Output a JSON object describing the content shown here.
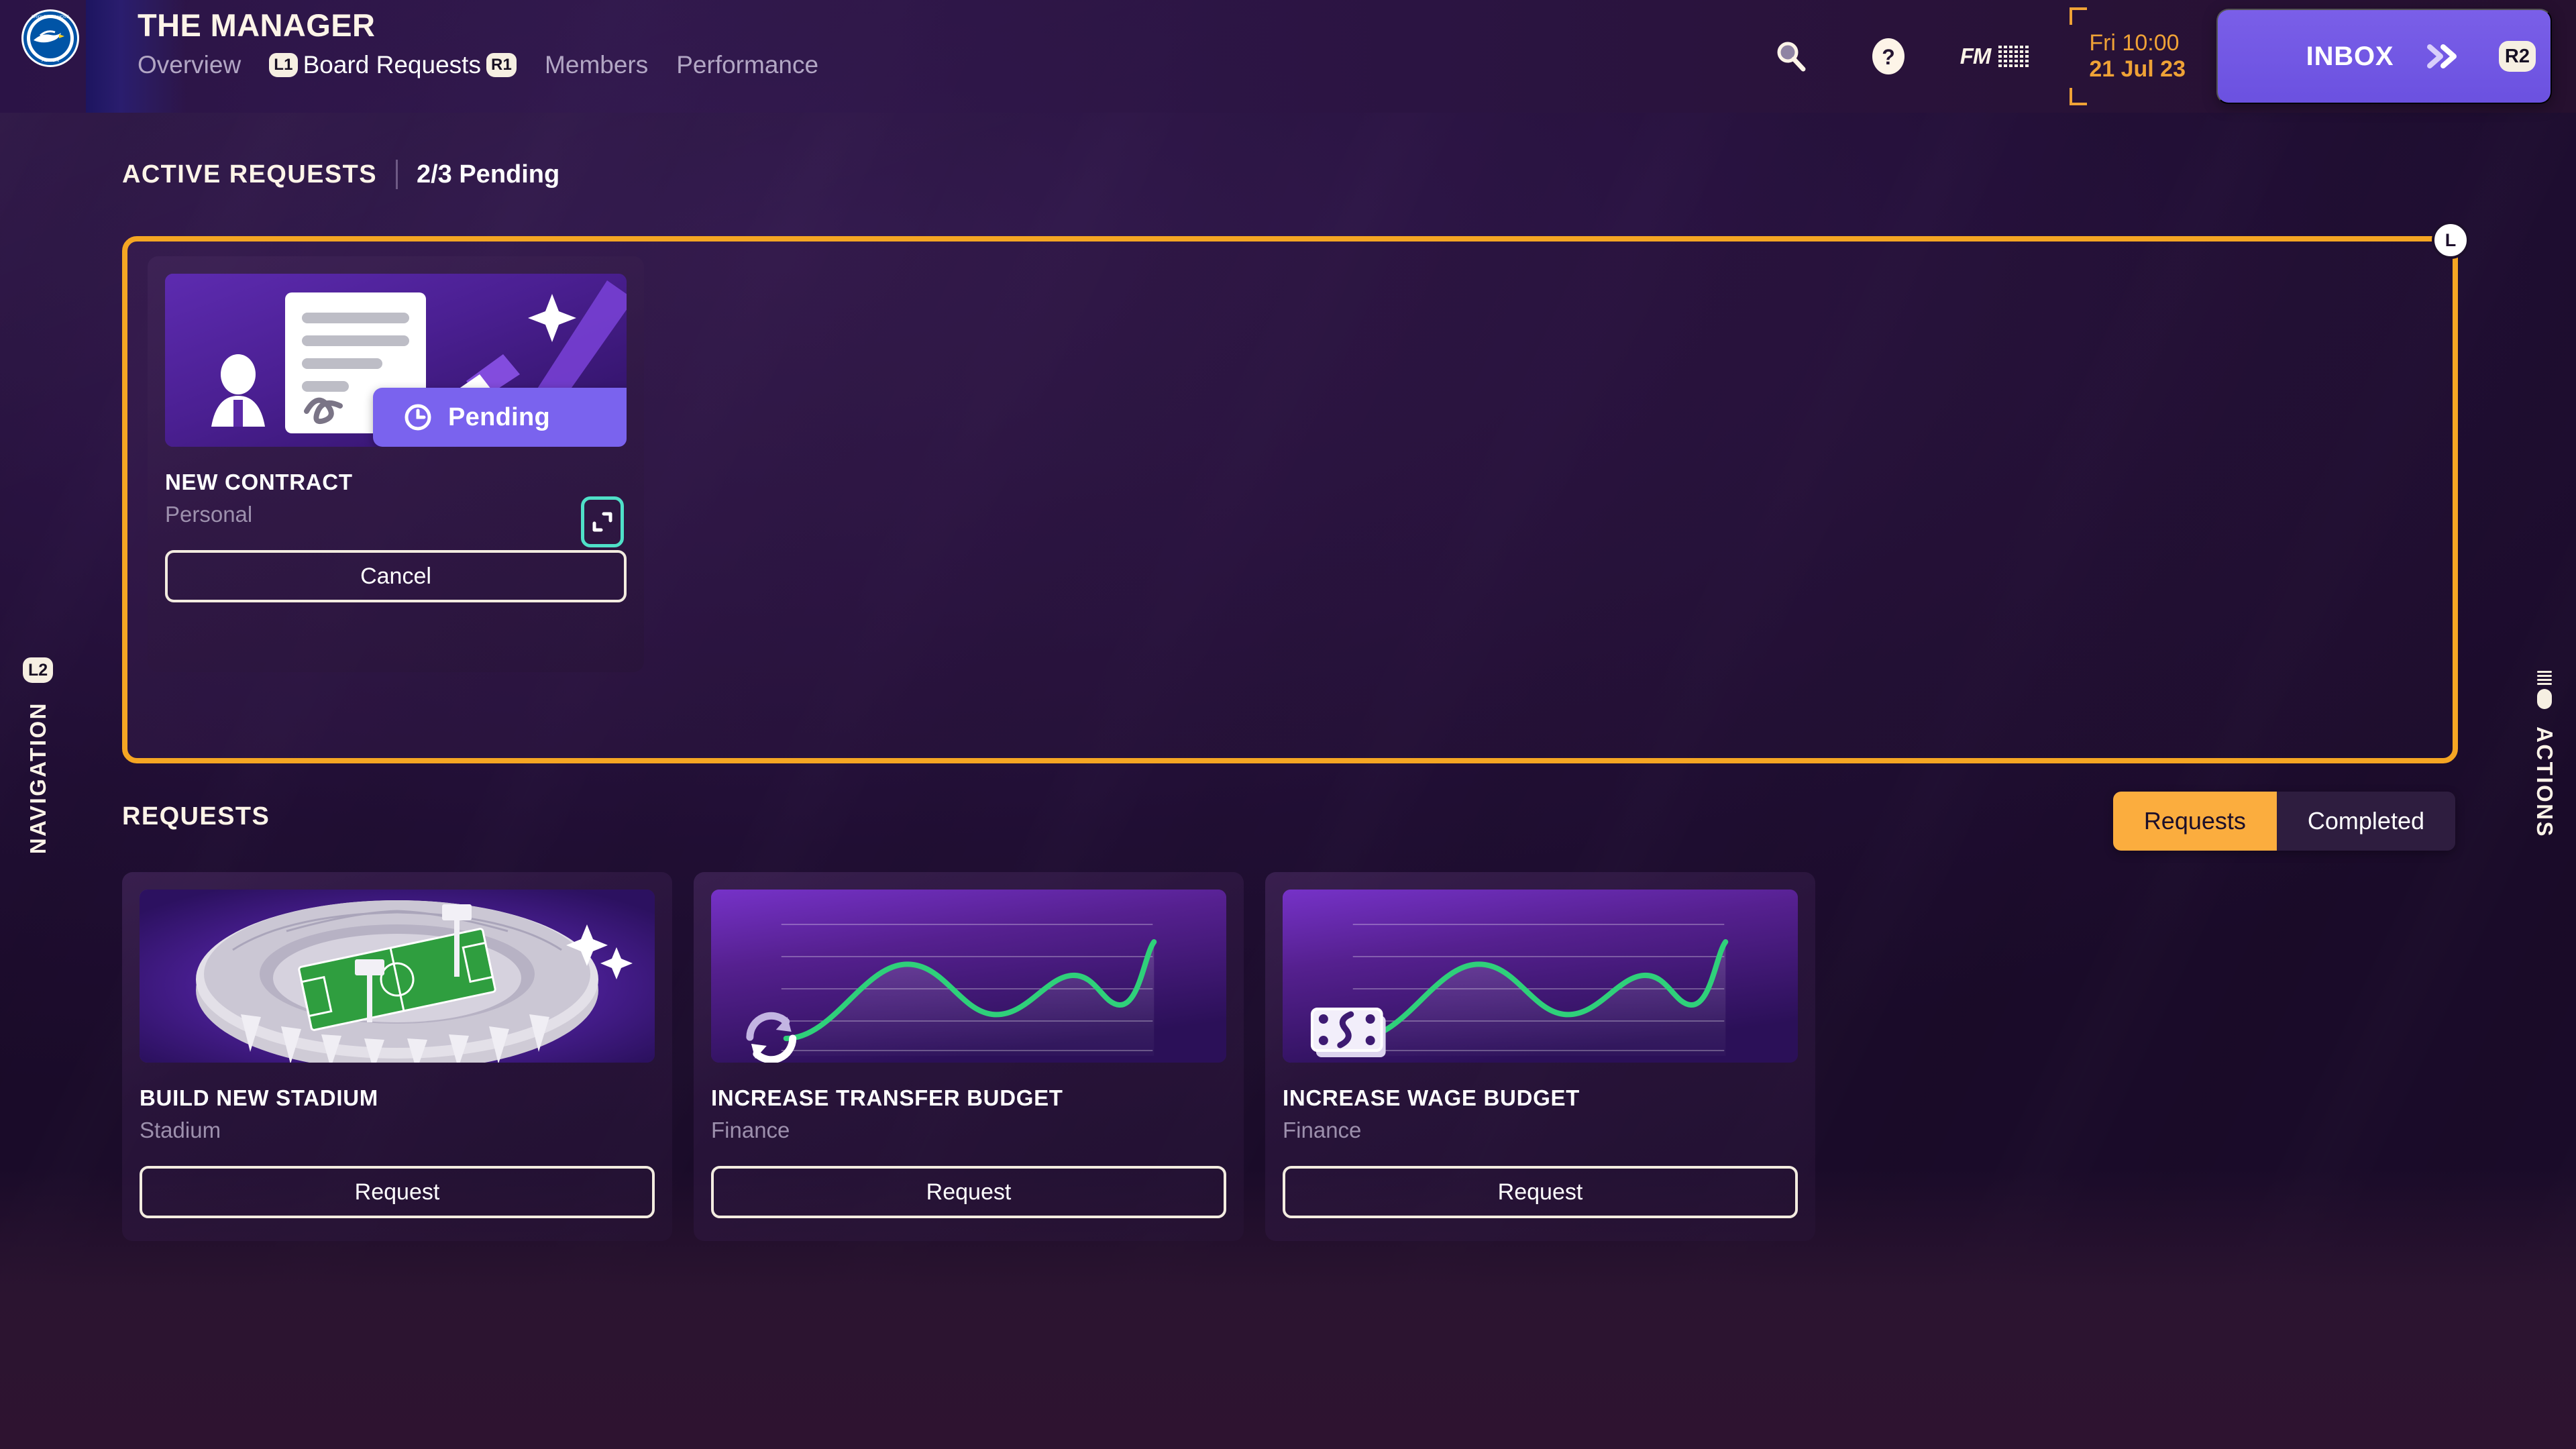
{
  "header": {
    "club_crest": "brighton-hove-albion-crest",
    "app_title": "THE MANAGER",
    "nav": [
      {
        "label": "Overview",
        "badge": "",
        "active": false
      },
      {
        "label": "Board Requests",
        "badge_left": "L1",
        "badge_right": "R1",
        "active": true
      },
      {
        "label": "Members",
        "badge": "",
        "active": false
      },
      {
        "label": "Performance",
        "badge": "",
        "active": false
      }
    ],
    "icons": {
      "search": "search-icon",
      "help": "help-icon",
      "fm_logo": "FM",
      "calendar": "calendar-icon"
    },
    "datetime": {
      "time": "Fri 10:00",
      "date": "21 Jul 23"
    },
    "inbox": {
      "label": "INBOX",
      "chevron": "»",
      "badge": "R2"
    }
  },
  "rails": {
    "left": {
      "badge": "L2",
      "label": "NAVIGATION"
    },
    "right": {
      "badge": "",
      "label": "ACTIONS",
      "icon": "menu-slider-icon"
    }
  },
  "active_section": {
    "title": "ACTIVE REQUESTS",
    "counter": "2/3 Pending",
    "panel_badge": "L",
    "card": {
      "title": "NEW CONTRACT",
      "subtitle": "Personal",
      "status": "Pending",
      "status_icon": "clock-icon",
      "expand_icon": "expand-icon",
      "button": "Cancel",
      "thumb": "contract-signature-illustration"
    }
  },
  "requests_section": {
    "title": "REQUESTS",
    "toggle": {
      "options": [
        "Requests",
        "Completed"
      ],
      "selected": "Requests"
    },
    "cards": [
      {
        "title": "BUILD NEW STADIUM",
        "subtitle": "Stadium",
        "button": "Request",
        "thumb": "stadium-illustration"
      },
      {
        "title": "INCREASE TRANSFER BUDGET",
        "subtitle": "Finance",
        "button": "Request",
        "thumb": "growth-chart-transfer-icon"
      },
      {
        "title": "INCREASE WAGE BUDGET",
        "subtitle": "Finance",
        "button": "Request",
        "thumb": "growth-chart-banknote-icon"
      }
    ]
  },
  "colors": {
    "accent_orange": "#f5a623",
    "toggle_active": "#fbad3e",
    "inbox_purple": "#6b51e0",
    "pending_purple": "#7a63ee",
    "teal": "#4fe0c8",
    "chart_green": "#2fd07a",
    "background": "#2a1342",
    "text_primary": "#fdf4e8",
    "text_muted": "#9d90ad"
  }
}
